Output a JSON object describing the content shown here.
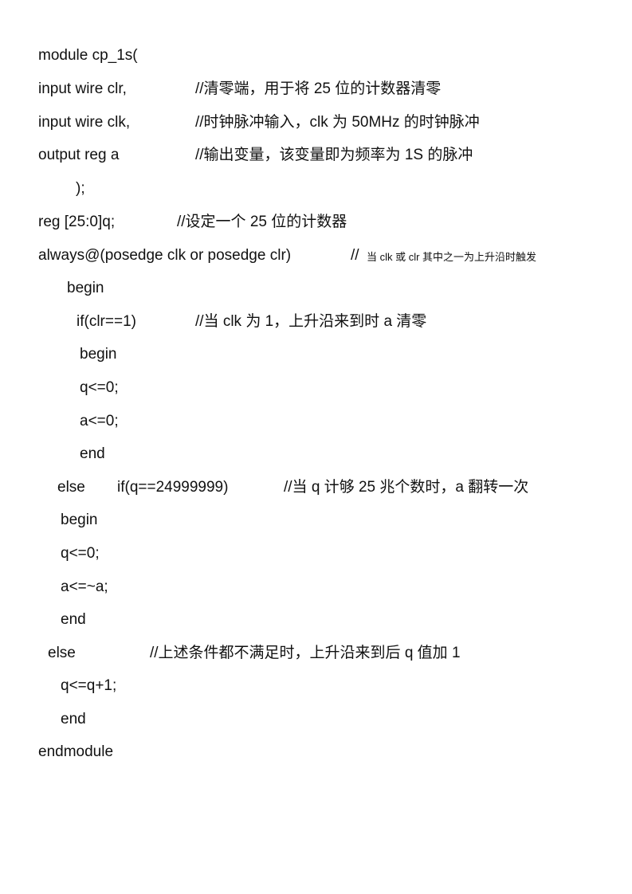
{
  "document": {
    "lines": [
      {
        "code": "module cp_1s(",
        "comment": ""
      },
      {
        "code": "input wire clr,",
        "comment": "//清零端，用于将 25 位的计数器清零"
      },
      {
        "code": "input wire clk,",
        "comment": "//时钟脉冲输入，clk 为 50MHz 的时钟脉冲"
      },
      {
        "code": "output reg a",
        "comment": "//输出变量，该变量即为频率为 1S 的脉冲"
      },
      {
        "code": ");",
        "comment": ""
      },
      {
        "code": "reg [25:0]q;",
        "comment": "//设定一个 25 位的计数器"
      },
      {
        "code": "always@(posedge clk or posedge clr)",
        "comment_prefix": "//",
        "comment": "当 clk 或 clr 其中之一为上升沿时触发"
      },
      {
        "code": "begin",
        "comment": ""
      },
      {
        "code": "if(clr==1)",
        "comment": "//当 clk 为 1，上升沿来到时 a 清零"
      },
      {
        "code": "begin",
        "comment": ""
      },
      {
        "code": "q<=0;",
        "comment": ""
      },
      {
        "code": "a<=0;",
        "comment": ""
      },
      {
        "code": "end",
        "comment": ""
      },
      {
        "code": "else",
        "code2": "if(q==24999999)",
        "comment": "//当 q 计够 25 兆个数时，a 翻转一次"
      },
      {
        "code": "begin",
        "comment": ""
      },
      {
        "code": "q<=0;",
        "comment": ""
      },
      {
        "code": "a<=~a;",
        "comment": ""
      },
      {
        "code": "end",
        "comment": ""
      },
      {
        "code": "else",
        "comment": "//上述条件都不满足时，上升沿来到后 q 值加 1"
      },
      {
        "code": "q<=q+1;",
        "comment": ""
      },
      {
        "code": "end",
        "comment": ""
      },
      {
        "code": "endmodule",
        "comment": ""
      }
    ]
  }
}
